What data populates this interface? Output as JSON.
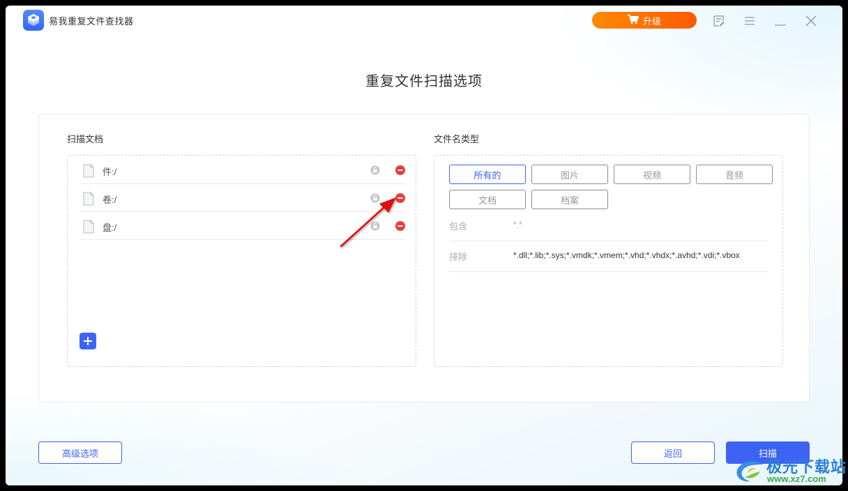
{
  "app": {
    "title": "易我重复文件查找器",
    "upgrade_label": "升级",
    "controls": [
      "feedback-icon",
      "menu-icon",
      "minimize-icon",
      "close-icon"
    ]
  },
  "page": {
    "title": "重复文件扫描选项"
  },
  "scan_folders": {
    "label": "扫描文档",
    "items": [
      {
        "path": "件:/",
        "icon": "file-icon"
      },
      {
        "path": "卷:/",
        "icon": "file-icon"
      },
      {
        "path": "盘:/",
        "icon": "file-icon"
      }
    ],
    "add_label": "+"
  },
  "file_types": {
    "label": "文件名类型",
    "options": [
      {
        "label": "所有的",
        "active": true
      },
      {
        "label": "图片",
        "active": false
      },
      {
        "label": "视频",
        "active": false
      },
      {
        "label": "音频",
        "active": false
      },
      {
        "label": "文档",
        "active": false
      },
      {
        "label": "档案",
        "active": false
      }
    ],
    "include_label": "包含",
    "include_value": "*.*",
    "exclude_label": "排除",
    "exclude_value": "*.dll;*.lib;*.sys;*.vmdk;*.vmem;*.vhd;*.vhdx;*.avhd;*.vdi;*.vbox"
  },
  "footer": {
    "advanced_label": "高级选项",
    "back_label": "返回",
    "scan_label": "扫描"
  },
  "watermark": {
    "line1": "极光下载站",
    "line2": "www.xz7.com"
  },
  "colors": {
    "accent": "#3d63f5",
    "upgrade_start": "#ff8a00",
    "upgrade_end": "#ff5a00",
    "remove": "#f03c3c",
    "annotation": "#e01010"
  }
}
